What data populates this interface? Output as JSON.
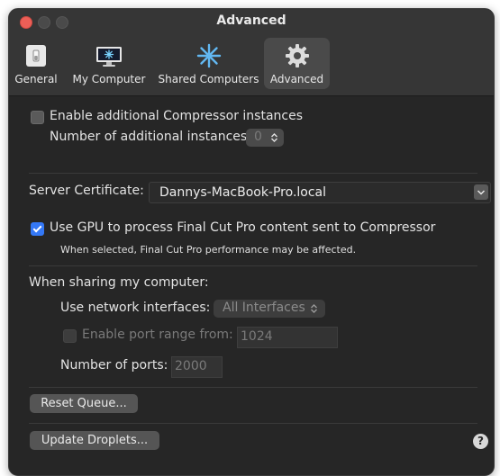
{
  "window": {
    "title": "Advanced"
  },
  "tabs": [
    {
      "label": "General",
      "icon": "general-switch-icon",
      "active": false
    },
    {
      "label": "My Computer",
      "icon": "my-computer-icon",
      "active": false
    },
    {
      "label": "Shared Computers",
      "icon": "shared-computers-icon",
      "active": false
    },
    {
      "label": "Advanced",
      "icon": "gear-icon",
      "active": true
    }
  ],
  "instances": {
    "enable_label": "Enable additional Compressor instances",
    "enabled": false,
    "count_label": "Number of additional instances:",
    "count_value": "0"
  },
  "certificate": {
    "label": "Server Certificate:",
    "value": "Dannys-MacBook-Pro.local"
  },
  "gpu": {
    "label": "Use GPU to process Final Cut Pro content sent to Compressor",
    "checked": true,
    "note": "When selected, Final Cut Pro performance may be affected."
  },
  "sharing": {
    "heading": "When sharing my computer:",
    "interfaces_label": "Use network interfaces:",
    "interfaces_value": "All Interfaces",
    "port_range_label": "Enable port range from:",
    "port_range_value": "1024",
    "ports_label": "Number of ports:",
    "ports_value": "2000"
  },
  "buttons": {
    "reset_queue": "Reset Queue...",
    "update_droplets": "Update Droplets...",
    "help": "?"
  },
  "colors": {
    "accent": "#3478f6",
    "window_bg": "#262626",
    "titlebar_bg": "#363636",
    "close": "#ec5f57"
  }
}
